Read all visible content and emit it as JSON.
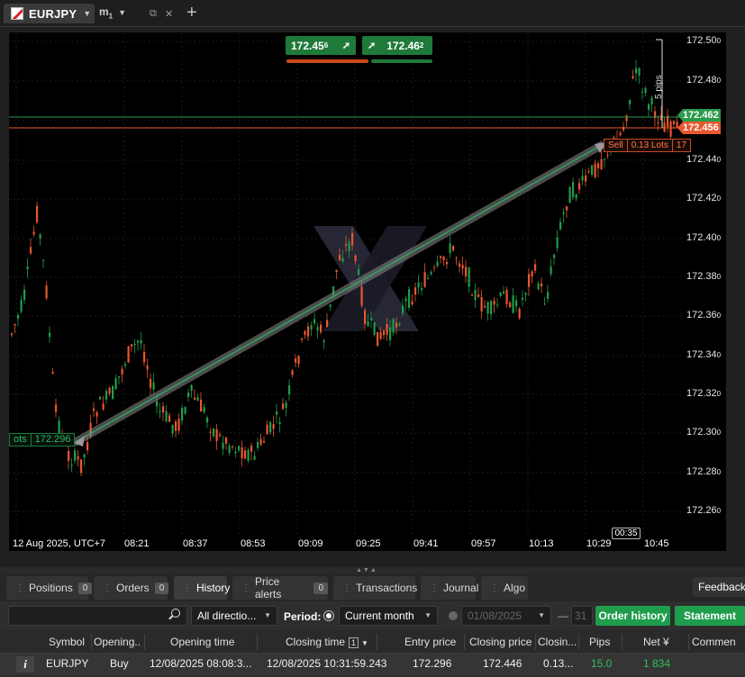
{
  "window": {
    "tab_symbol": "EURJPY",
    "timeframe": "m",
    "timeframe_sub": "1",
    "plus_icon": "+"
  },
  "quotes": {
    "sell_price": "172.45",
    "sell_sub": "6",
    "buy_price": "172.46",
    "buy_sub": "2",
    "arrow_glyph": "➚"
  },
  "y_axis": [
    {
      "value": "172.50",
      "sub": "0"
    },
    {
      "value": "172.48",
      "sub": "0"
    },
    {
      "value": "172.44",
      "sub": "0"
    },
    {
      "value": "172.42",
      "sub": "0"
    },
    {
      "value": "172.40",
      "sub": "0"
    },
    {
      "value": "172.38",
      "sub": "0"
    },
    {
      "value": "172.36",
      "sub": "0"
    },
    {
      "value": "172.34",
      "sub": "0"
    },
    {
      "value": "172.32",
      "sub": "0"
    },
    {
      "value": "172.30",
      "sub": "0"
    },
    {
      "value": "172.28",
      "sub": "0"
    },
    {
      "value": "172.26",
      "sub": "0"
    }
  ],
  "x_axis": [
    "12 Aug 2025, UTC+7",
    "08:21",
    "08:37",
    "08:53",
    "09:09",
    "09:25",
    "09:41",
    "09:57",
    "10:13",
    "10:29",
    "10:45"
  ],
  "price_tags": {
    "ask": "172.462",
    "bid": "172.456"
  },
  "position_labels": {
    "sell_side": "Sell",
    "sell_lots": "0.13 Lots",
    "sell_price_fragment": "17",
    "buy_lots_fragment": "ots",
    "buy_price": "172.296"
  },
  "cursor_time": "00:35",
  "pips_text": "5 pips",
  "bottom_tabs": [
    {
      "label": "Positions",
      "count": "0"
    },
    {
      "label": "Orders",
      "count": "0"
    },
    {
      "label": "History",
      "count": ""
    },
    {
      "label": "Price alerts",
      "count": "0"
    },
    {
      "label": "Transactions",
      "count": ""
    },
    {
      "label": "Journal",
      "count": ""
    },
    {
      "label": "Algo",
      "count": ""
    }
  ],
  "feedback_label": "Feedback",
  "toolbar": {
    "direction_select": "All directio...",
    "period_label": "Period:",
    "period_select": "Current month",
    "date_from": "01/08/2025",
    "date_to_fragment": "31",
    "order_history_button": "Order history",
    "statement_button": "Statement"
  },
  "table": {
    "columns": [
      "Symbol",
      "Opening..",
      "Opening time",
      "Closing time",
      "1",
      "Entry price",
      "Closing price",
      "Closin...",
      "Pips",
      "Net ¥",
      "Commen"
    ],
    "rows": [
      {
        "symbol": "EURJPY",
        "direction": "Buy",
        "opening_time": "12/08/2025 08:08:3...",
        "closing_time": "12/08/2025 10:31:59.243",
        "entry_price": "172.296",
        "closing_price": "172.446",
        "closing_qty": "0.13...",
        "pips": "15.0",
        "net": "1 834"
      }
    ]
  },
  "colors": {
    "bull": "#1f9d4d",
    "bear": "#e8572d",
    "ask_line": "#2a9a4c",
    "bid_line": "#e8572d"
  }
}
